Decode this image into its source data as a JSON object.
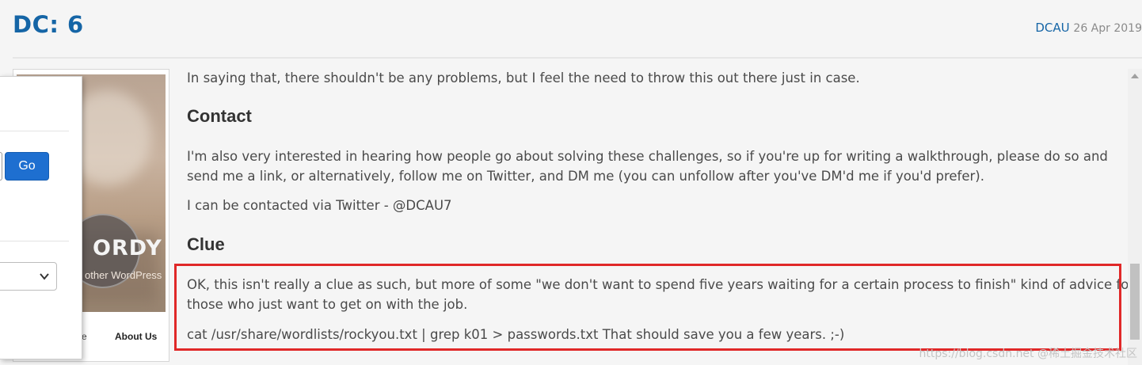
{
  "header": {
    "title": "DC: 6",
    "author": "DCAU",
    "date": "26 Apr 2019"
  },
  "sidebar_thumbnail": {
    "brand_text": "ORDY",
    "subtitle_text": "other WordPress",
    "nav_fragment": "e",
    "nav_about": "About Us"
  },
  "overlay_panel": {
    "go_button_label": "Go"
  },
  "content": {
    "intro": "In saying that, there shouldn't be any problems, but I feel the need to throw this out there just in case.",
    "contact_heading": "Contact",
    "contact_p1_line1": "I'm also very interested in hearing how people go about solving these challenges, so if you're up for writing a walkthrough, please do so and",
    "contact_p1_line2": "send me a link, or alternatively, follow me on Twitter, and DM me (you can unfollow after you've DM'd me if you'd prefer).",
    "contact_p2": "I can be contacted via Twitter - @DCAU7",
    "clue_heading": "Clue",
    "clue_p1_line1": "OK, this isn't really a clue as such, but more of some \"we don't want to spend five years waiting for a certain process to finish\" kind of advice for",
    "clue_p1_line2": "those who just want to get on with the job.",
    "clue_p2": "cat /usr/share/wordlists/rockyou.txt | grep k01 > passwords.txt That should save you a few years. ;-)"
  },
  "watermark": "https://blog.csdn.net  @稀土掘金技术社区",
  "colors": {
    "accent": "#1565a6",
    "highlight_border": "#e02828",
    "button": "#1e6fd0"
  }
}
